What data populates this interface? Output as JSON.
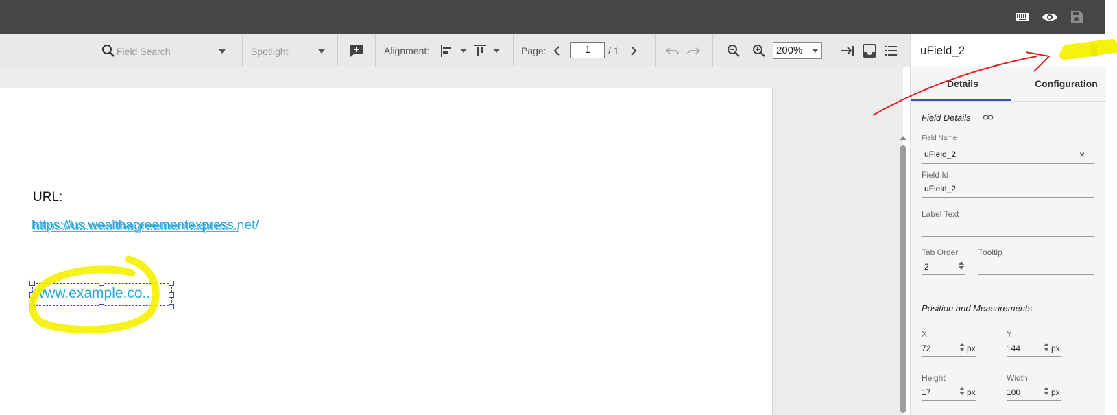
{
  "topbar": {
    "icons": [
      "keyboard-icon",
      "eye-icon",
      "save-icon"
    ]
  },
  "toolbar": {
    "field_search_placeholder": "Field Search",
    "spotlight_label": "Spotlight",
    "alignment_label": "Alignment:",
    "page_label": "Page:",
    "page_current": "1",
    "page_total": "/ 1",
    "zoom_value": "200%",
    "icons": [
      "search-icon",
      "add-field-icon",
      "align-left-icon",
      "align-top-icon",
      "chevron-left-icon",
      "chevron-right-icon",
      "undo-icon",
      "redo-icon",
      "zoom-out-icon",
      "zoom-in-icon",
      "tab-order-icon",
      "inbox-icon",
      "list-icon"
    ]
  },
  "document": {
    "url_label": "URL:",
    "link_text_a": "https://us.wealthagreementexpress.net/",
    "link_text_b": "https://us.wealthagreementexpres...",
    "selected_field_text": "www.example.co..."
  },
  "panel": {
    "title": "uField_2",
    "tabs": [
      "Details",
      "Configuration"
    ],
    "active_tab": "Details",
    "field_details": {
      "section_title": "Field Details",
      "field_name_label": "Field Name",
      "field_name_value": "uField_2",
      "clear_symbol": "×",
      "field_id_label": "Field Id",
      "field_id_value": "uField_2",
      "label_text_label": "Label Text",
      "label_text_value": "",
      "tab_order_label": "Tab Order",
      "tab_order_value": "2",
      "tooltip_label": "Tooltip",
      "tooltip_value": ""
    },
    "position": {
      "section_title": "Position and Measurements",
      "x_label": "X",
      "x_value": "72",
      "y_label": "Y",
      "y_value": "144",
      "height_label": "Height",
      "height_value": "17",
      "width_label": "Width",
      "width_value": "100",
      "unit": "px"
    }
  },
  "colors": {
    "topbar": "#464646",
    "toolbar": "#e9e9e9",
    "link": "#29a7e1",
    "selection": "#4040c8",
    "tab_indicator": "#3f51b5",
    "annotation_yellow": "#f5f000",
    "annotation_red": "#e02020"
  }
}
